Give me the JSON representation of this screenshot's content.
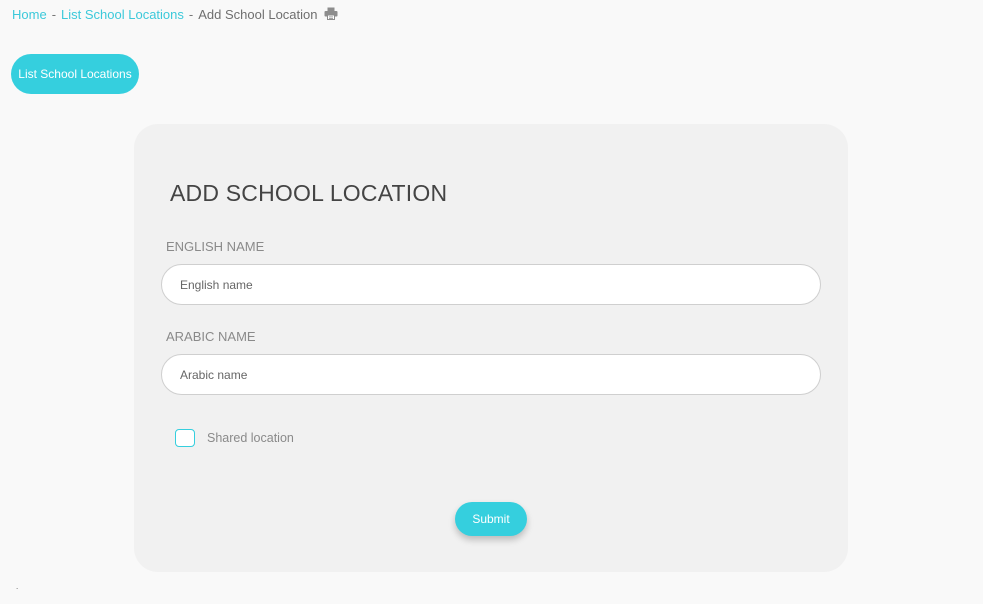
{
  "breadcrumb": {
    "home": "Home",
    "separator": "-",
    "list": "List School Locations",
    "current": "Add School Location"
  },
  "icons": {
    "print": "print-icon"
  },
  "header": {
    "list_button": "List School Locations"
  },
  "form": {
    "title": "ADD SCHOOL LOCATION",
    "english_label": "ENGLISH NAME",
    "english_placeholder": "English name",
    "english_value": "",
    "arabic_label": "ARABIC NAME",
    "arabic_placeholder": "Arabic name",
    "arabic_value": "",
    "shared_label": "Shared location",
    "shared_checked": false,
    "submit": "Submit"
  },
  "footer": {
    "mark": "."
  },
  "colors": {
    "accent": "#35cfde",
    "link": "#3cc9da",
    "background": "#f9f9f9",
    "card": "#f1f1f1"
  }
}
